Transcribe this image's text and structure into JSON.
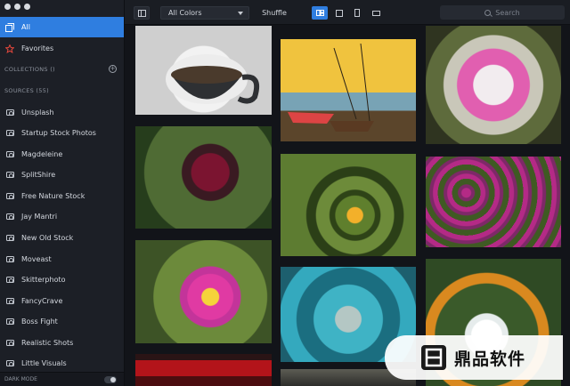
{
  "sidebar": {
    "all_label": "All",
    "favorites_label": "Favorites",
    "collections_heading": "COLLECTIONS ()",
    "sources_heading": "SOURCES (55)",
    "sources": [
      "Unsplash",
      "Startup Stock Photos",
      "Magdeleine",
      "SplitShire",
      "Free Nature Stock",
      "Jay Mantri",
      "New Old Stock",
      "Moveast",
      "Skitterphoto",
      "FancyCrave",
      "Boss Fight",
      "Realistic Shots",
      "Little Visuals"
    ],
    "dark_mode_label": "DARK MODE"
  },
  "toolbar": {
    "color_filter_value": "All Colors",
    "shuffle_label": "Shuffle",
    "search_placeholder": "Search"
  },
  "watermark": {
    "text": "鼎品软件"
  },
  "colors": {
    "accent": "#2f7ee0",
    "sidebar_bg": "#1c1f26",
    "content_bg": "#121419",
    "favorite_star": "#e2473c"
  }
}
